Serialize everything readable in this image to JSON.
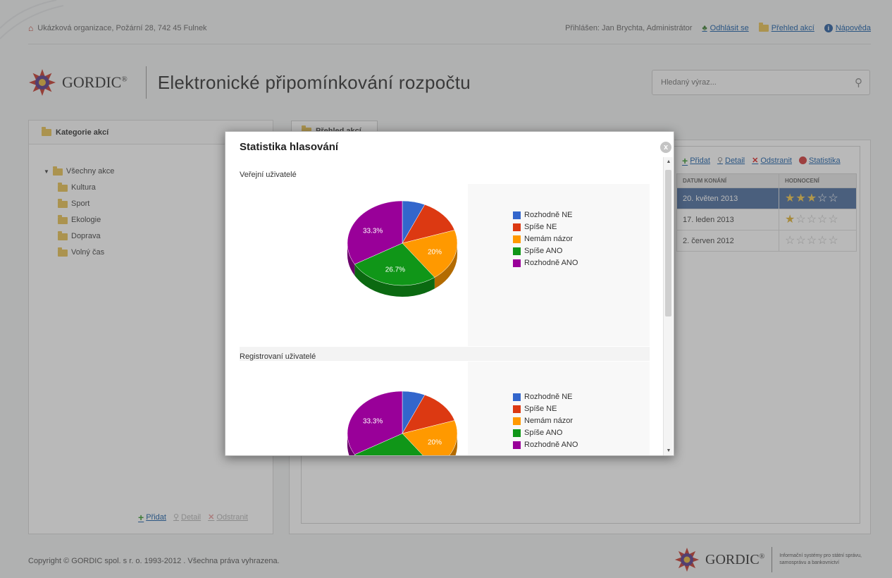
{
  "topbar": {
    "org": "Ukázková organizace, Požární 28, 742 45 Fulnek",
    "user": "Přihlášen: Jan Brychta, Administrátor",
    "logout": "Odhlásit se",
    "overview": "Přehled akcí",
    "help": "Nápověda"
  },
  "brand": {
    "logo": "GORDIC",
    "logo_mark": "®",
    "title": "Elektronické připomínkování rozpočtu"
  },
  "search": {
    "placeholder": "Hledaný výraz..."
  },
  "left_panel": {
    "title": "Kategorie akcí",
    "root": "Všechny akce",
    "items": [
      "Kultura",
      "Sport",
      "Ekologie",
      "Doprava",
      "Volný čas"
    ],
    "add": "Přidat",
    "detail": "Detail",
    "delete": "Odstranit"
  },
  "right_panel": {
    "tab": "Přehled akcí",
    "add": "Přidat",
    "detail": "Detail",
    "delete": "Odstranit",
    "stats": "Statistika",
    "columns": {
      "date": "DATUM KONÁNÍ",
      "rating": "HODNOCENÍ"
    },
    "rows": [
      {
        "date": "20. květen 2013",
        "rating": 2.5
      },
      {
        "date": "17. leden 2013",
        "rating": 1
      },
      {
        "date": "2. červen 2012",
        "rating": 0
      }
    ]
  },
  "modal": {
    "title": "Statistika hlasování",
    "close": "x",
    "section1": "Veřejní uživatelé",
    "section2": "Registrovaní uživatelé",
    "legend": [
      "Rozhodně NE",
      "Spíše NE",
      "Nemám názor",
      "Spíše ANO",
      "Rozhodně ANO"
    ],
    "colors": [
      "#3366cc",
      "#dc3912",
      "#ff9900",
      "#109618",
      "#990099"
    ],
    "scroll_up": "▲",
    "scroll_down": "▼"
  },
  "chart_data": [
    {
      "type": "pie",
      "title": "Veřejní uživatelé",
      "categories": [
        "Rozhodně NE",
        "Spíše NE",
        "Nemám názor",
        "Spíše ANO",
        "Rozhodně ANO"
      ],
      "values": [
        6.7,
        13.3,
        20,
        26.7,
        33.3
      ],
      "data_labels": [
        "",
        "",
        "20%",
        "26.7%",
        "33.3%"
      ],
      "legend": "right"
    },
    {
      "type": "pie",
      "title": "Registrovaní uživatelé",
      "categories": [
        "Rozhodně NE",
        "Spíše NE",
        "Nemám názor",
        "Spíše ANO",
        "Rozhodně ANO"
      ],
      "values": [
        6.7,
        13.3,
        20,
        26.7,
        33.3
      ],
      "data_labels": [
        "",
        "",
        "20%",
        "",
        "33.3%"
      ],
      "legend": "right"
    }
  ],
  "footer": {
    "copyright": "Copyright © GORDIC spol. s r. o. 1993-2012 . Všechna práva vyhrazena.",
    "logo": "GORDIC",
    "logo_mark": "®",
    "subtitle": "Informační systémy pro státní správu, samosprávu a bankovnictví"
  }
}
